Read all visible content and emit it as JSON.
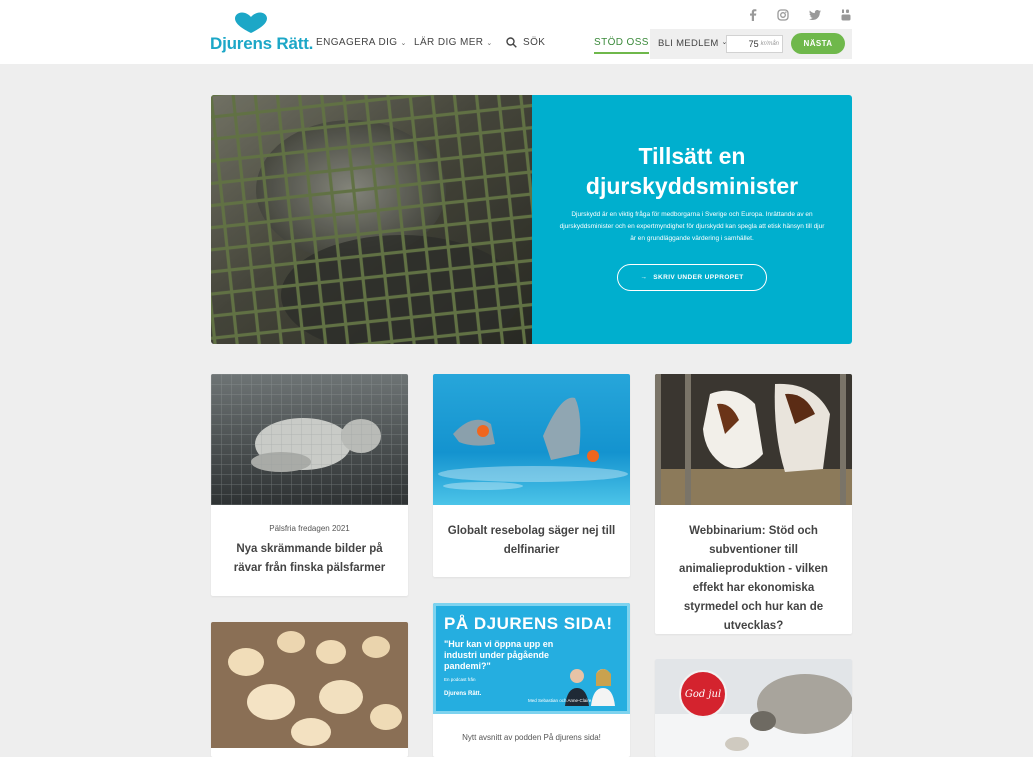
{
  "header": {
    "logo_text": "Djurens Rätt.",
    "nav": {
      "engage": "ENGAGERA DIG",
      "learn": "LÄR DIG MER",
      "search": "SÖK",
      "support": "STÖD OSS"
    },
    "member": {
      "label": "BLI MEDLEM",
      "amount": "75",
      "unit": "kr/mån",
      "next": "NÄSTA"
    },
    "social_icons": [
      "facebook-icon",
      "instagram-icon",
      "twitter-icon",
      "youtube-icon"
    ]
  },
  "hero": {
    "title": "Tillsätt en djurskyddsminister",
    "text": "Djurskydd är en viktig fråga för medborgarna i Sverige och Europa. Inrättande av en djurskyddsminister och en expertmyndighet för djurskydd kan spegla att etisk hänsyn till djur är en grundläggande värdering i samhället.",
    "button": "SKRIV UNDER UPPROPET"
  },
  "cards": [
    {
      "tag": "Pälsfria fredagen 2021",
      "title": "Nya skrämmande bilder på rävar från finska pälsfarmer"
    },
    {
      "tag": "",
      "title": "Globalt resebolag säger nej till delfinarier"
    },
    {
      "tag": "",
      "title": "Webbinarium: Stöd och subventioner till animalieproduktion - vilken effekt har ekonomiska styrmedel och hur kan de utvecklas?"
    },
    {
      "tag": "",
      "title": ""
    },
    {
      "tag": "Nytt avsnitt av podden På djurens sida!",
      "title": "",
      "podcast": {
        "headline": "PÅ DJURENS SIDA!",
        "quote": "\"Hur kan vi öppna upp en industri under pågående pandemi?\"",
        "small": "En podcast från",
        "brand": "Djurens Rätt.",
        "guests": "Med Sebastian och Anne-Claire"
      }
    },
    {
      "tag": "",
      "title": "",
      "badge": "God jul"
    }
  ],
  "colors": {
    "brand_teal": "#1ca7c7",
    "hero_blue": "#00afce",
    "accent_green": "#6fb84b",
    "page_bg": "#eeeeee"
  }
}
